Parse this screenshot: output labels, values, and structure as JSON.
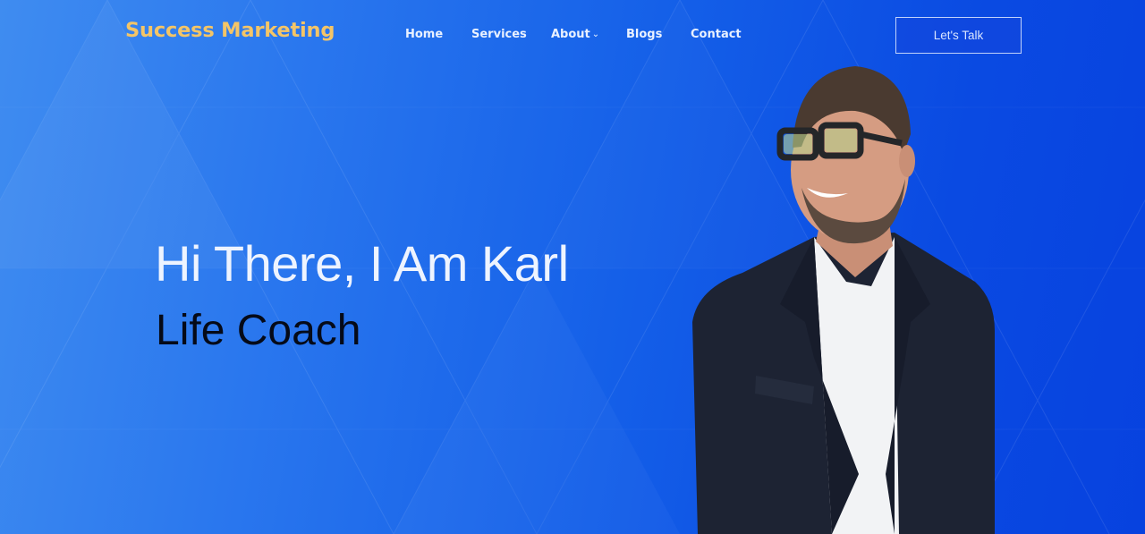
{
  "brand": {
    "name": "Success Marketing",
    "color": "#f4c567"
  },
  "nav": {
    "items": [
      {
        "label": "Home",
        "has_dropdown": false
      },
      {
        "label": "Services",
        "has_dropdown": false
      },
      {
        "label": "About",
        "has_dropdown": true
      },
      {
        "label": "Blogs",
        "has_dropdown": false
      },
      {
        "label": "Contact",
        "has_dropdown": false
      }
    ],
    "dropdown_icon": "chevron-down-icon"
  },
  "cta": {
    "label": "Let's Talk"
  },
  "hero": {
    "title": "Hi There, I Am Karl",
    "subtitle": "Life Coach",
    "background_start": "#3f8cf0",
    "background_end": "#0742df"
  }
}
